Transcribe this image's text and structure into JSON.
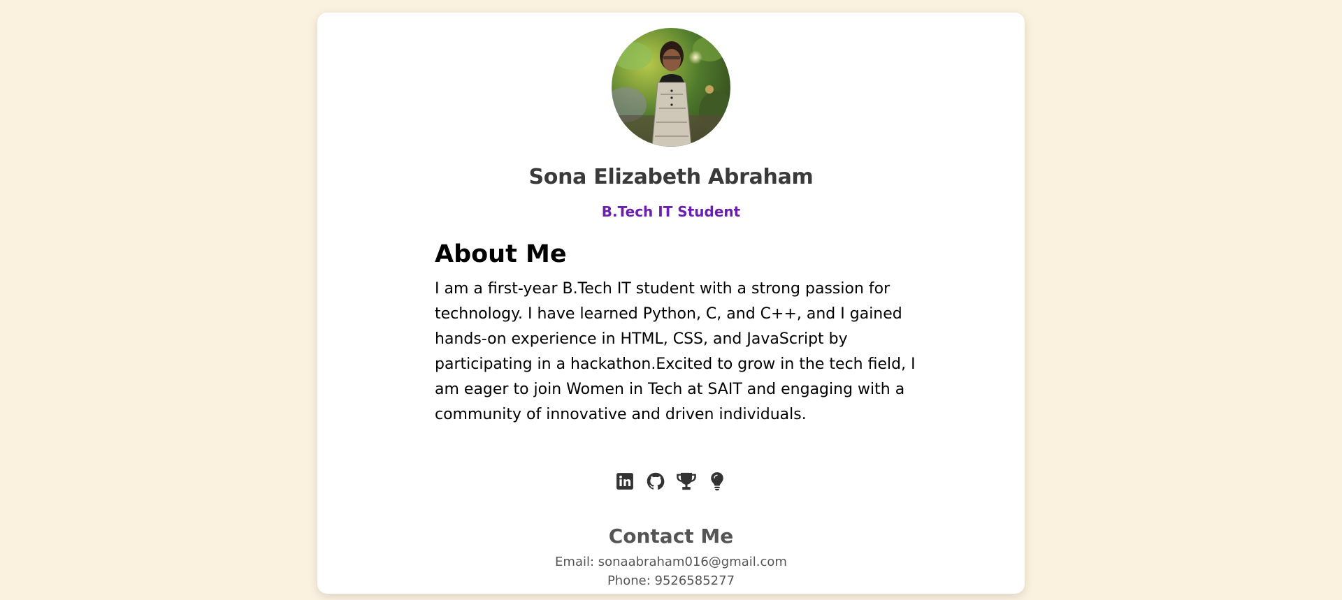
{
  "profile": {
    "name": "Sona Elizabeth Abraham",
    "role": "B.Tech IT Student",
    "avatar_icon": "profile-photo"
  },
  "about": {
    "heading": "About Me",
    "text": "I am a first-year B.Tech IT student with a strong passion for technology. I have learned Python, C, and C++, and I gained hands-on experience in HTML, CSS, and JavaScript by participating in a hackathon.Excited to grow in the tech field, I am eager to join Women in Tech at SAIT and engaging with a community of innovative and driven individuals."
  },
  "socials": [
    {
      "icon": "linkedin-icon"
    },
    {
      "icon": "github-icon"
    },
    {
      "icon": "trophy-icon"
    },
    {
      "icon": "lightbulb-icon"
    }
  ],
  "contact": {
    "heading": "Contact Me",
    "email": "Email: sonaabraham016@gmail.com",
    "phone": "Phone: 9526585277"
  },
  "colors": {
    "background": "#faf1de",
    "card": "#ffffff",
    "accent": "#6a1fb0",
    "icon": "#333333"
  }
}
